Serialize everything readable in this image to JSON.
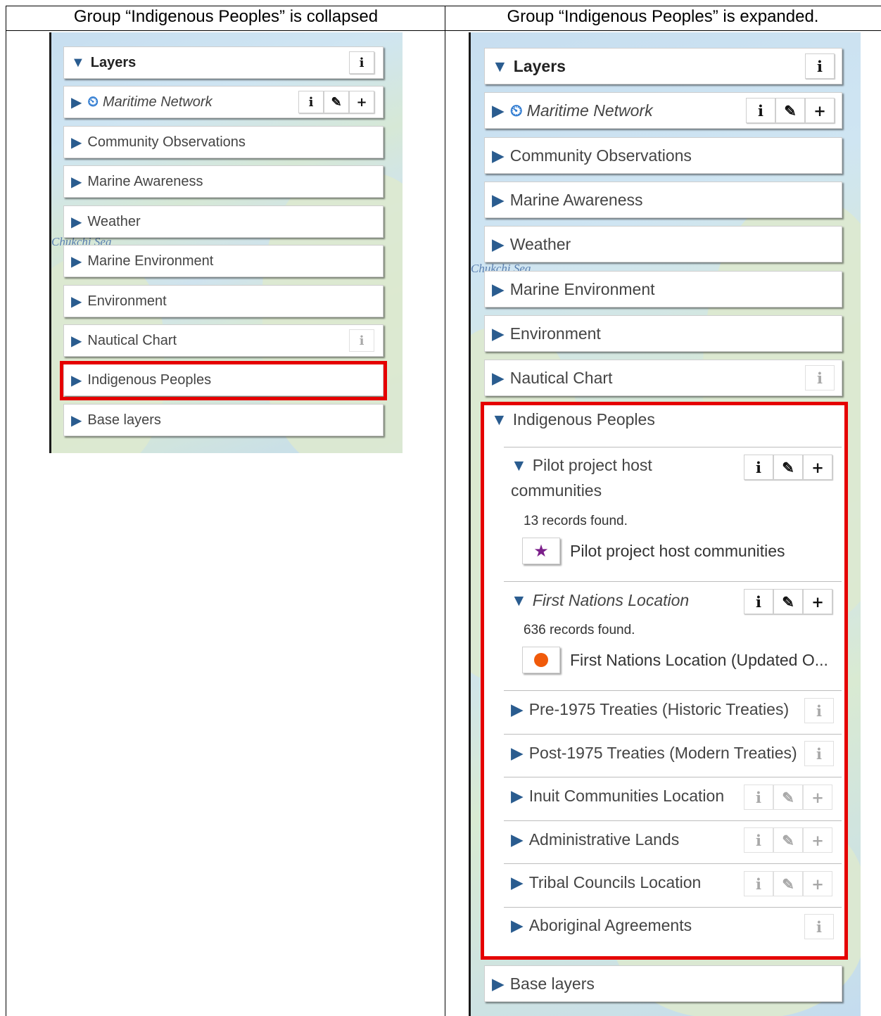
{
  "headers": {
    "left": "Group “Indigenous Peoples” is collapsed",
    "right": "Group “Indigenous Peoples” is expanded."
  },
  "map": {
    "sea_label": "Chukchi Sea"
  },
  "panel": {
    "title": "Layers",
    "rows": [
      {
        "label": "Maritime Network",
        "italic": true
      },
      {
        "label": "Community Observations"
      },
      {
        "label": "Marine Awareness"
      },
      {
        "label": "Weather"
      },
      {
        "label": "Marine Environment"
      },
      {
        "label": "Environment"
      },
      {
        "label": "Nautical Chart"
      },
      {
        "label": "Indigenous Peoples"
      },
      {
        "label": "Base layers"
      }
    ]
  },
  "buttons": {
    "info": "i",
    "edit": "✎",
    "add": "+"
  },
  "group": {
    "title": "Indigenous Peoples",
    "sublayers": [
      {
        "label_line1": "Pilot project host",
        "label_line2": "communities",
        "records": "13 records found.",
        "legend_label": "Pilot project host communities"
      },
      {
        "label": "First Nations Location",
        "records": "636 records found.",
        "legend_label": "First Nations Location (Updated O..."
      },
      {
        "label": "Pre-1975 Treaties (Historic Treaties)"
      },
      {
        "label": "Post-1975 Treaties (Modern Treaties)"
      },
      {
        "label": "Inuit Communities Location"
      },
      {
        "label": "Administrative Lands"
      },
      {
        "label": "Tribal Councils Location"
      },
      {
        "label": "Aboriginal Agreements"
      }
    ]
  },
  "colors": {
    "highlight": "#e50000",
    "triangle": "#2a5c8f",
    "clock_icon": "#2f7bd1",
    "star_icon": "#7b1f8a",
    "dot_icon": "#f05a0a"
  }
}
